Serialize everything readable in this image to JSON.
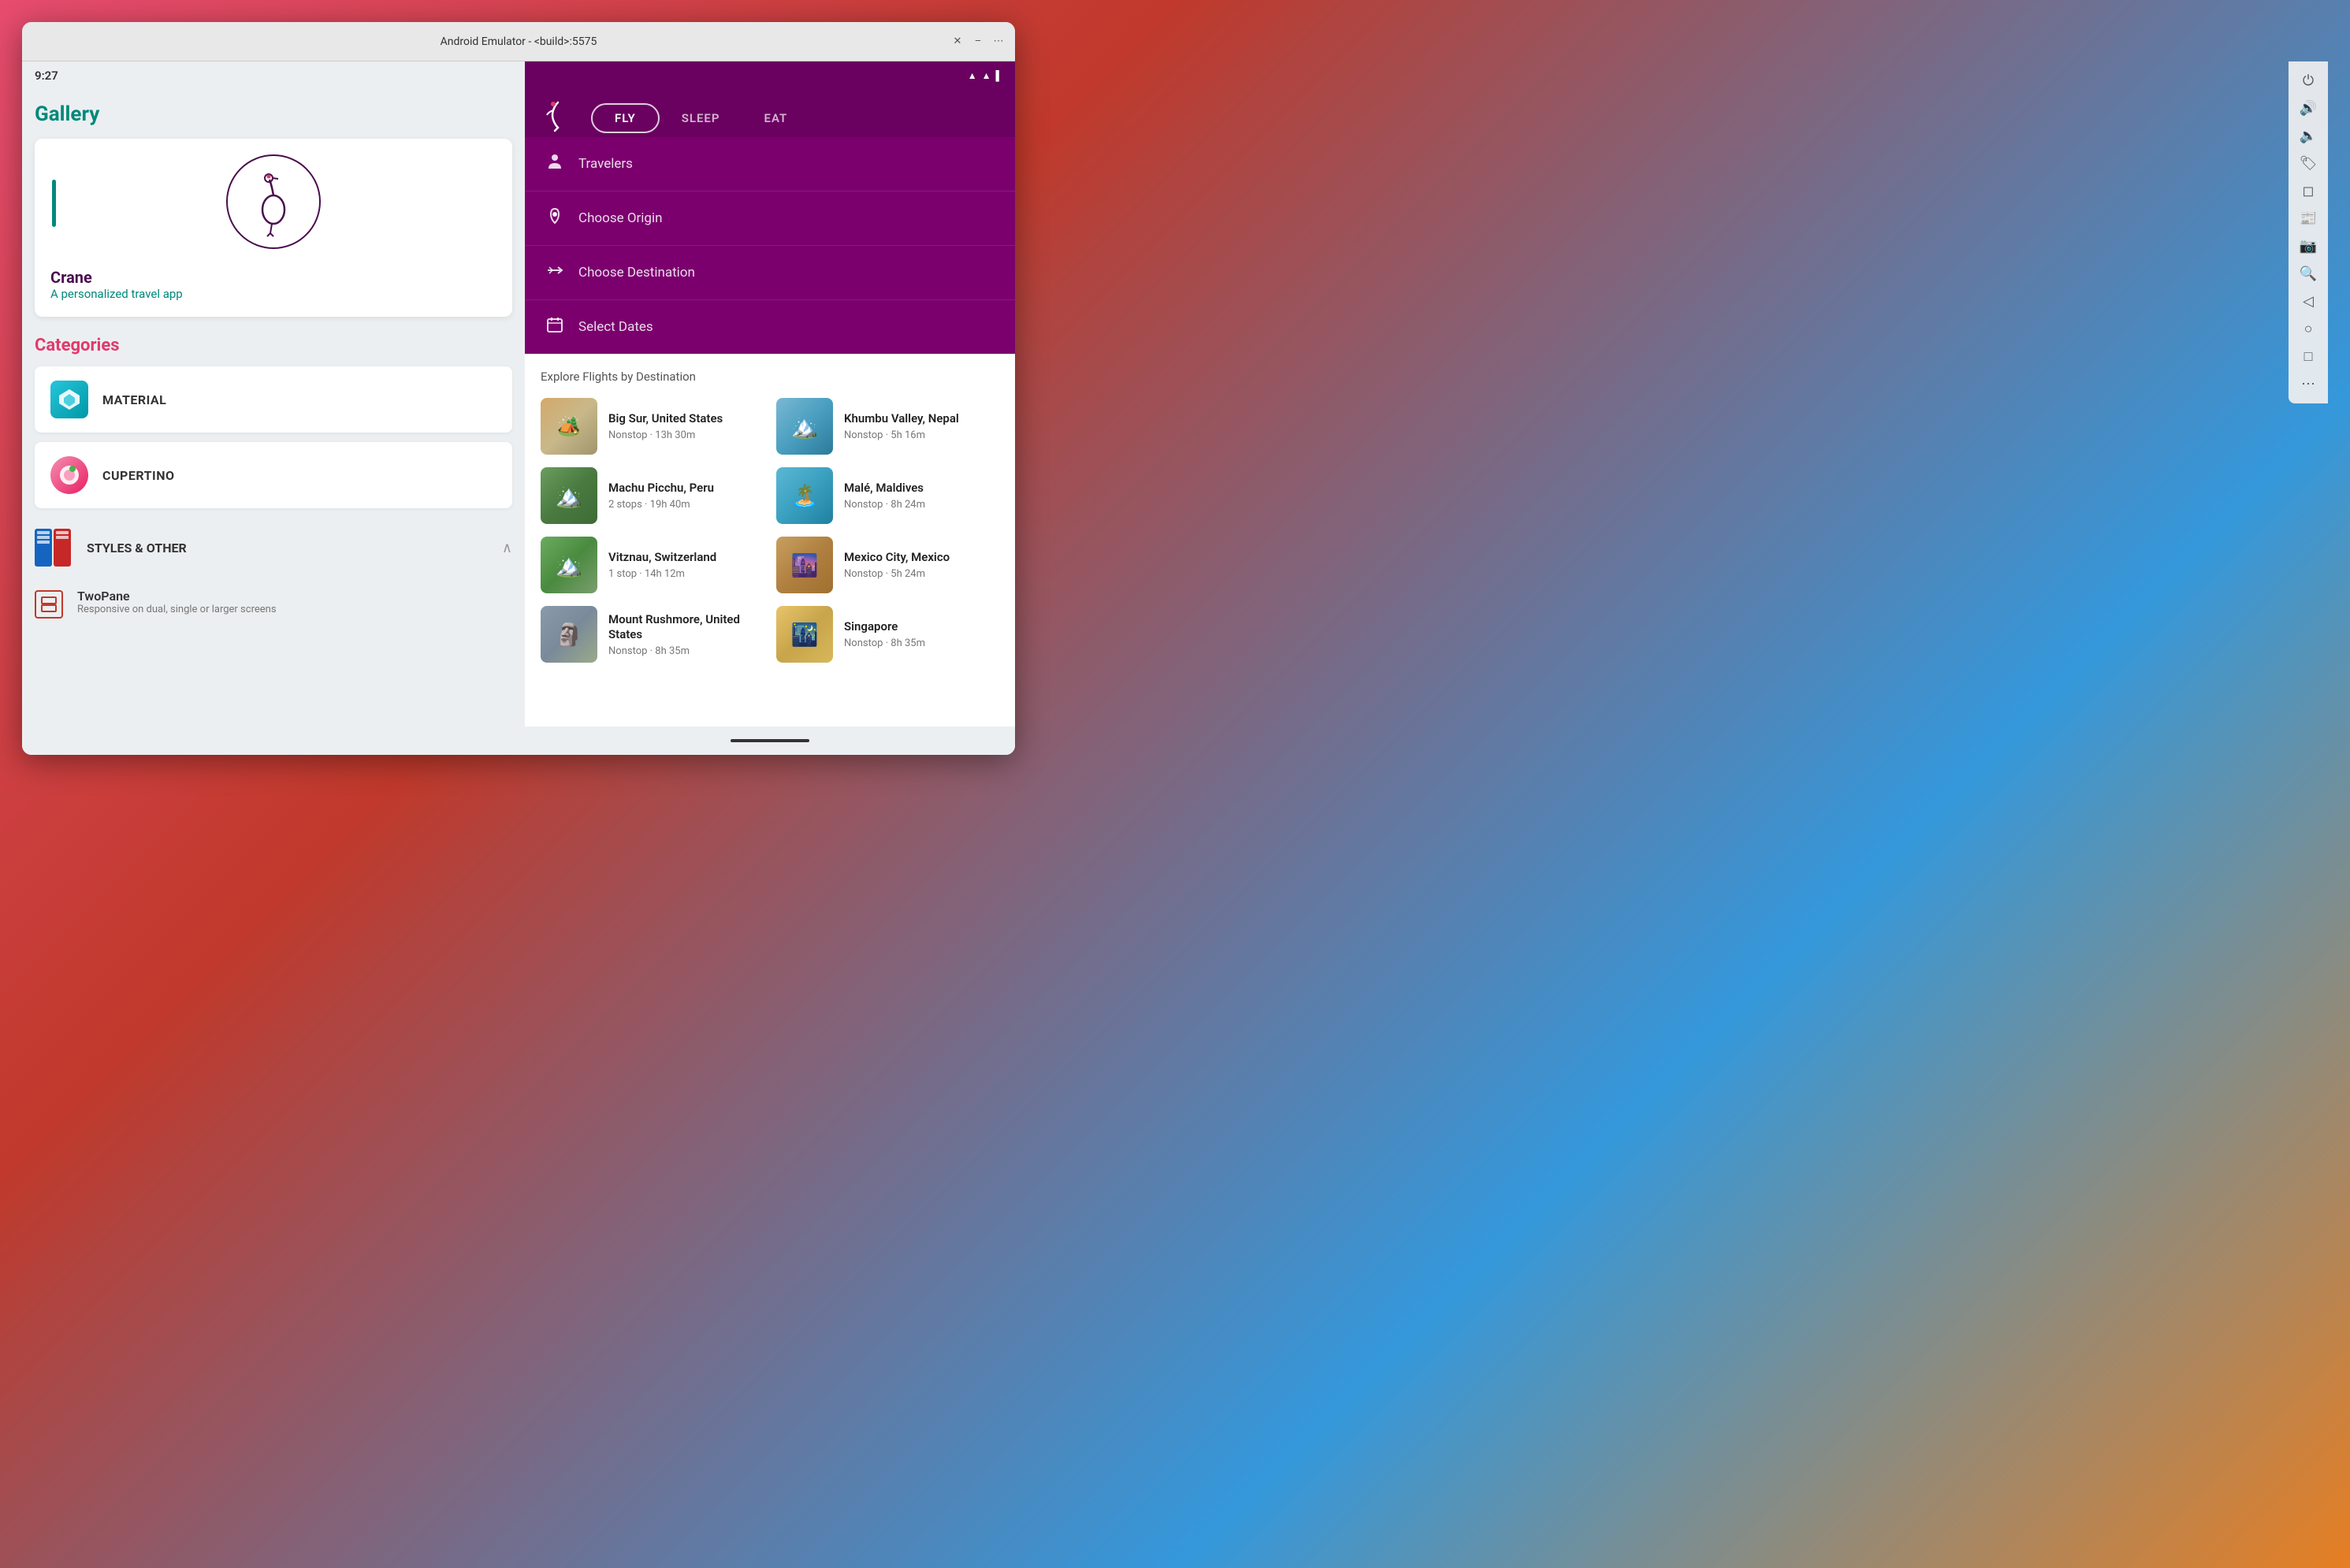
{
  "window": {
    "title": "Android Emulator - <build>:5575",
    "close": "✕",
    "minimize": "–",
    "more": "⋯"
  },
  "left": {
    "status_time": "9:27",
    "gallery_title": "Gallery",
    "featured": {
      "name": "Crane",
      "description": "A personalized travel app"
    },
    "categories_title": "Categories",
    "categories": [
      {
        "id": "material",
        "label": "MATERIAL"
      },
      {
        "id": "cupertino",
        "label": "CUPERTINO"
      }
    ],
    "styles_label": "STYLES & OTHER",
    "twopane": {
      "name": "TwoPane",
      "description": "Responsive on dual, single or larger screens"
    }
  },
  "right": {
    "nav": {
      "fly": "FLY",
      "sleep": "SLEEP",
      "eat": "EAT"
    },
    "form": {
      "travelers_label": "Travelers",
      "origin_label": "Choose Origin",
      "destination_label": "Choose Destination",
      "dates_label": "Select Dates"
    },
    "explore": {
      "title": "Explore Flights by Destination",
      "destinations": [
        {
          "id": "big-sur",
          "name": "Big Sur, United States",
          "detail": "Nonstop · 13h 30m",
          "img_class": "img-big-sur",
          "emoji": "🏕️"
        },
        {
          "id": "khumbu",
          "name": "Khumbu Valley, Nepal",
          "detail": "Nonstop · 5h 16m",
          "img_class": "img-khumbu",
          "emoji": "🏔️"
        },
        {
          "id": "machu-picchu",
          "name": "Machu Picchu, Peru",
          "detail": "2 stops · 19h 40m",
          "img_class": "img-machu-picchu",
          "emoji": "🏔️"
        },
        {
          "id": "male",
          "name": "Malé, Maldives",
          "detail": "Nonstop · 8h 24m",
          "img_class": "img-male",
          "emoji": "🏝️"
        },
        {
          "id": "vitznau",
          "name": "Vitznau, Switzerland",
          "detail": "1 stop · 14h 12m",
          "img_class": "img-vitznau",
          "emoji": "🏔️"
        },
        {
          "id": "mexico-city",
          "name": "Mexico City, Mexico",
          "detail": "Nonstop · 5h 24m",
          "img_class": "img-mexico-city",
          "emoji": "🌆"
        },
        {
          "id": "mount-rushmore",
          "name": "Mount Rushmore, United States",
          "detail": "Nonstop · 8h 35m",
          "img_class": "img-mount-rushmore",
          "emoji": "🗿"
        },
        {
          "id": "singapore",
          "name": "Singapore",
          "detail": "Nonstop · 8h 35m",
          "img_class": "img-singapore",
          "emoji": "🌃"
        }
      ]
    }
  }
}
